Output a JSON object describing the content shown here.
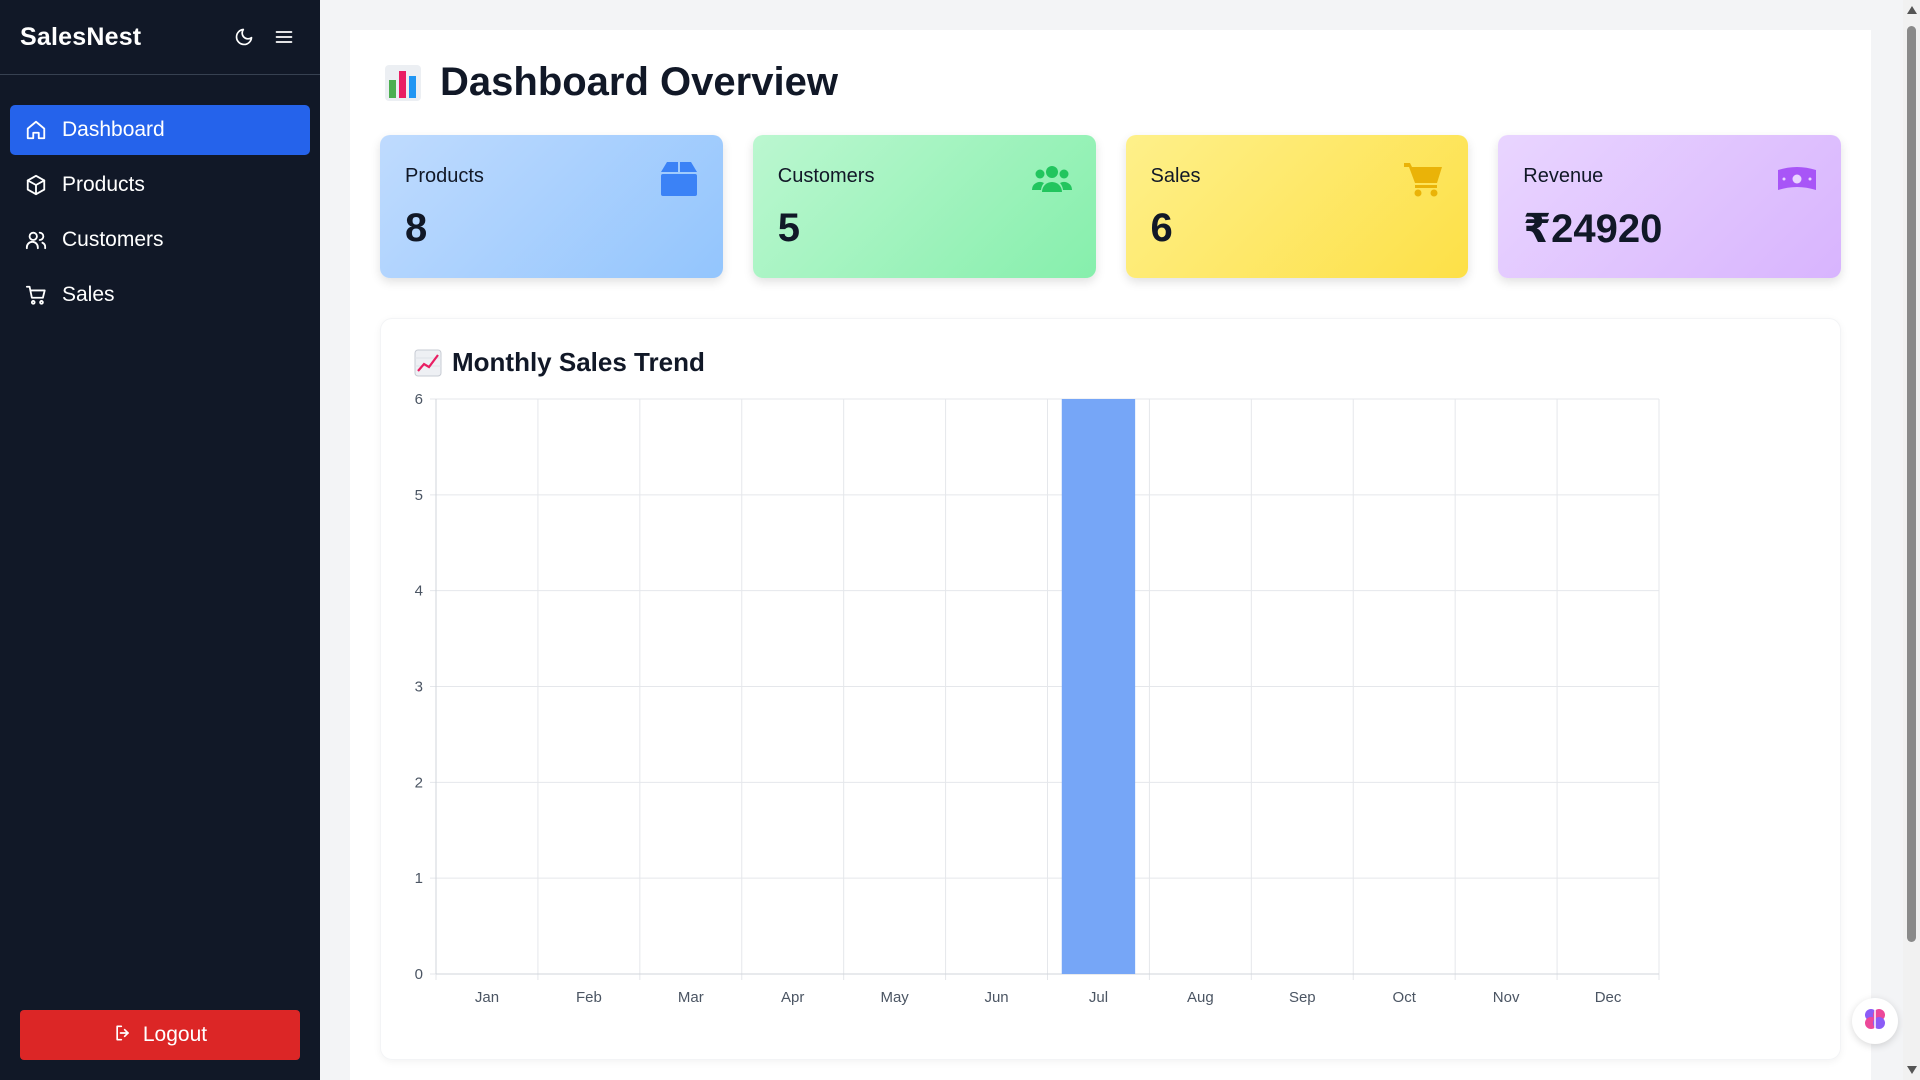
{
  "sidebar": {
    "brand": "SalesNest",
    "theme_toggle_icon": "moon-icon",
    "menu_icon": "hamburger-menu-icon",
    "items": [
      {
        "label": "Dashboard",
        "icon": "home-icon",
        "active": true
      },
      {
        "label": "Products",
        "icon": "box-icon",
        "active": false
      },
      {
        "label": "Customers",
        "icon": "users-icon",
        "active": false
      },
      {
        "label": "Sales",
        "icon": "cart-icon",
        "active": false
      }
    ],
    "logout_label": "Logout",
    "logout_icon": "logout-icon"
  },
  "main": {
    "title": "Dashboard Overview",
    "title_icon": "bar-chart-emoji-icon",
    "cards": [
      {
        "label": "Products",
        "value": "8",
        "icon": "box-icon",
        "icon_color": "#3b82f6"
      },
      {
        "label": "Customers",
        "value": "5",
        "icon": "users-icon",
        "icon_color": "#22c55e"
      },
      {
        "label": "Sales",
        "value": "6",
        "icon": "cart-icon",
        "icon_color": "#eab308"
      },
      {
        "label": "Revenue",
        "value": "₹24920",
        "icon": "money-icon",
        "icon_color": "#a855f7"
      }
    ],
    "chart_title": "Monthly Sales Trend",
    "chart_title_icon": "trend-chart-emoji-icon"
  },
  "colors": {
    "sidebar_bg": "#111827",
    "active_nav": "#2563eb",
    "logout_bg": "#dc2626",
    "bar_color": "#76a6f7"
  },
  "chart_data": {
    "type": "bar",
    "categories": [
      "Jan",
      "Feb",
      "Mar",
      "Apr",
      "May",
      "Jun",
      "Jul",
      "Aug",
      "Sep",
      "Oct",
      "Nov",
      "Dec"
    ],
    "values": [
      0,
      0,
      0,
      0,
      0,
      0,
      6,
      0,
      0,
      0,
      0,
      0
    ],
    "ylim": [
      0,
      6
    ],
    "yticks": [
      0,
      1,
      2,
      3,
      4,
      5,
      6
    ],
    "grid": true,
    "legend": "none"
  }
}
